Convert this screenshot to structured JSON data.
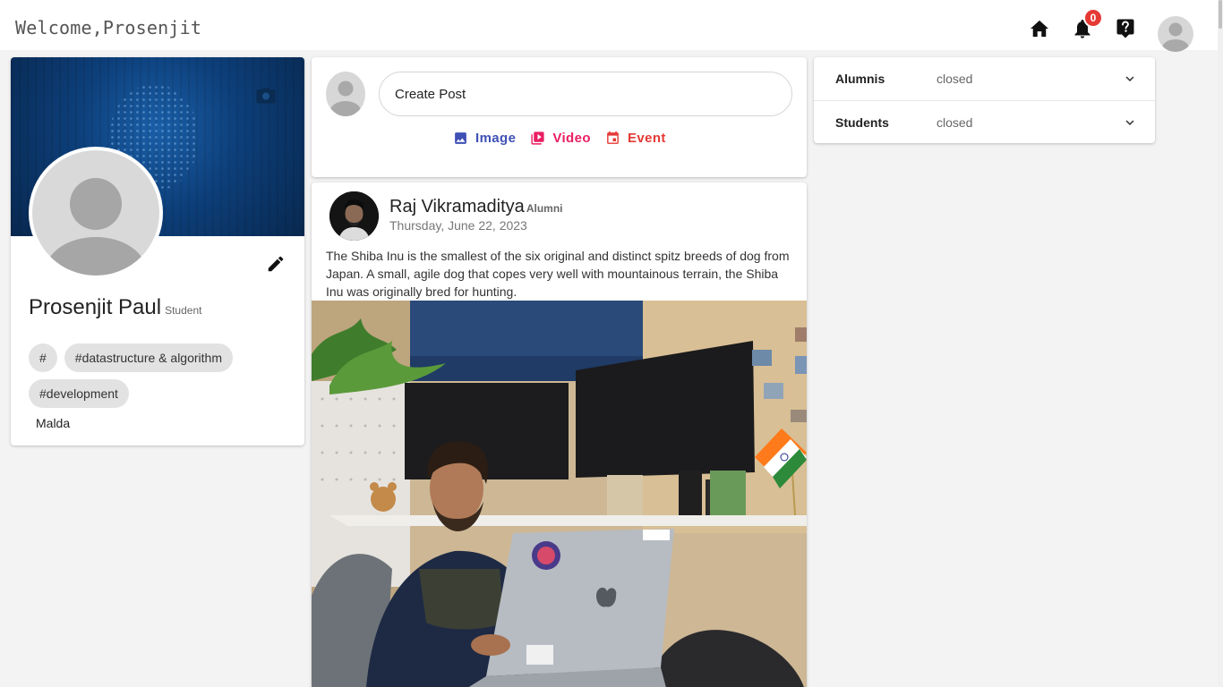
{
  "header": {
    "welcome_text": "Welcome,Prosenjit",
    "notification_count": "0",
    "icons": [
      "home-icon",
      "bell-icon",
      "help-icon",
      "account-avatar"
    ]
  },
  "profile": {
    "name": "Prosenjit Paul",
    "role": "Student",
    "tags": [
      "#",
      "#datastructure & algorithm",
      "#development"
    ],
    "location": "Malda"
  },
  "create_post": {
    "placeholder": "Create Post",
    "actions": [
      {
        "label": "Image",
        "icon": "image-icon",
        "color": "#3f51b5"
      },
      {
        "label": "Video",
        "icon": "video-icon",
        "color": "#e91e63"
      },
      {
        "label": "Event",
        "icon": "event-icon",
        "color": "#e53935"
      }
    ]
  },
  "post": {
    "author": "Raj Vikramaditya",
    "author_role": "Alumni",
    "date": "Thursday, June 22, 2023",
    "text": "The Shiba Inu is the smallest of the six original and distinct spitz breeds of dog from Japan. A small, agile dog that copes very well with mountainous terrain, the Shiba Inu was originally bred for hunting."
  },
  "sidebar": {
    "sections": [
      {
        "title": "Alumnis",
        "status": "closed"
      },
      {
        "title": "Students",
        "status": "closed"
      }
    ]
  }
}
